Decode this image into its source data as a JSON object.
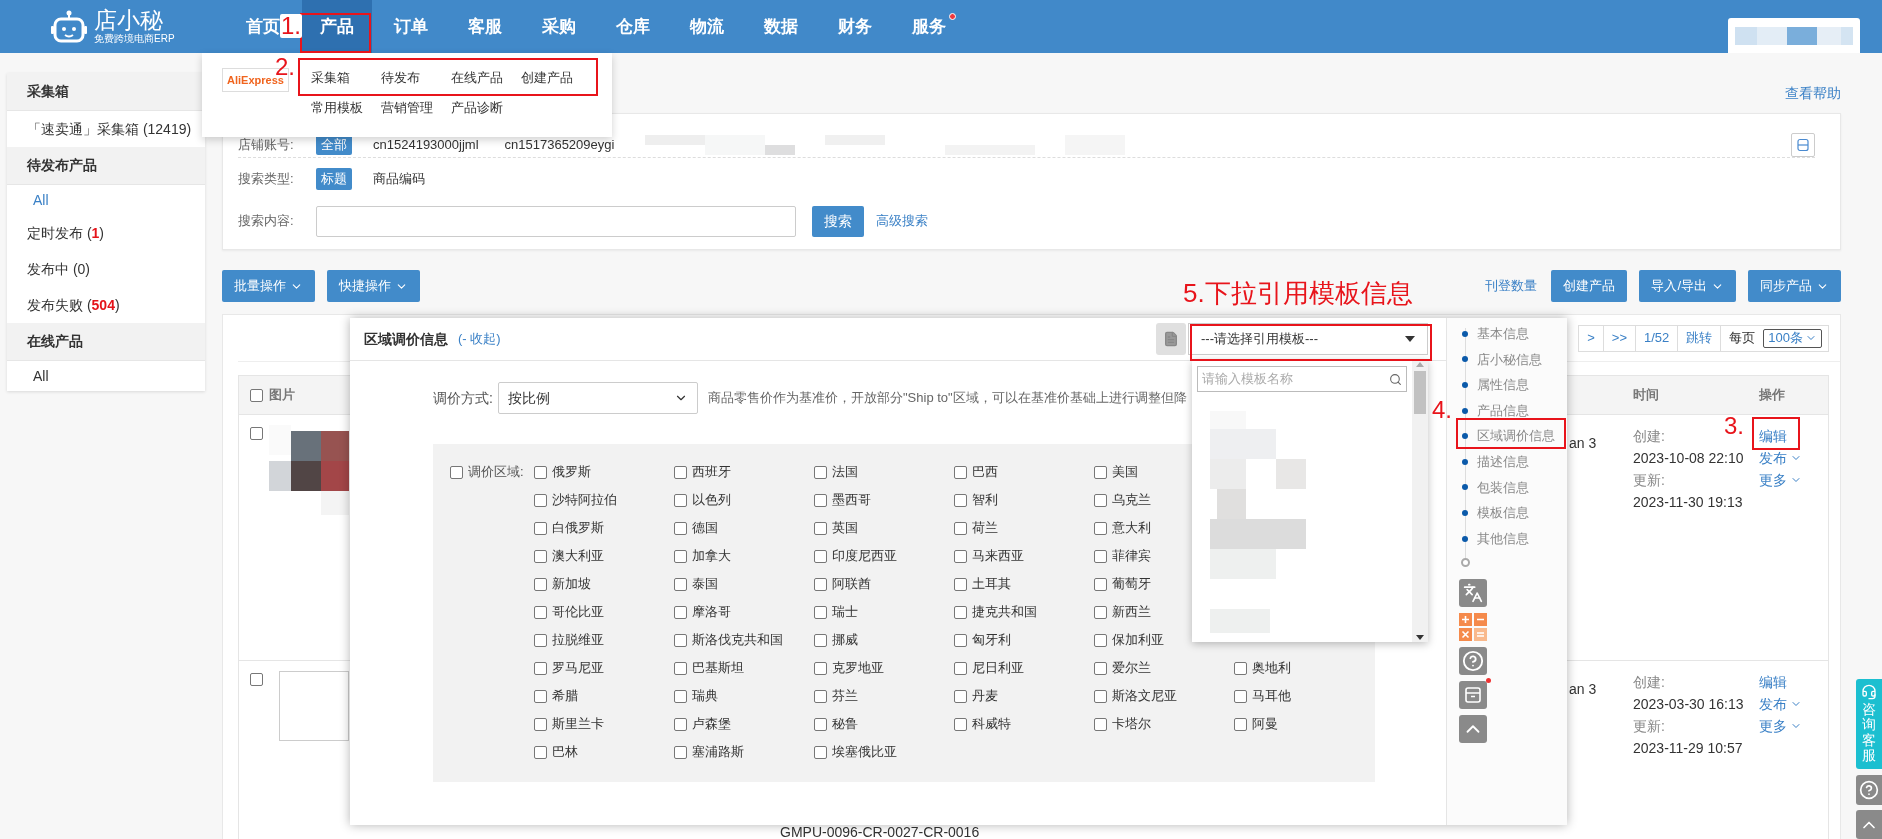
{
  "topbar": {
    "logo_name": "店小秘",
    "logo_tagline": "免费跨境电商ERP",
    "nav": [
      {
        "label": "首页",
        "selected": false,
        "badge": false
      },
      {
        "label": "产品",
        "selected": true,
        "badge": false
      },
      {
        "label": "订单",
        "selected": false,
        "badge": false
      },
      {
        "label": "客服",
        "selected": false,
        "badge": false
      },
      {
        "label": "采购",
        "selected": false,
        "badge": false
      },
      {
        "label": "仓库",
        "selected": false,
        "badge": false
      },
      {
        "label": "物流",
        "selected": false,
        "badge": false
      },
      {
        "label": "数据",
        "selected": false,
        "badge": false
      },
      {
        "label": "财务",
        "selected": false,
        "badge": false
      },
      {
        "label": "服务",
        "selected": false,
        "badge": true
      }
    ],
    "account": {
      "kind": "picture"
    }
  },
  "product_menu": {
    "platform": "AliExpress",
    "rows": [
      [
        "采集箱",
        "待发布",
        "在线产品",
        "创建产品"
      ],
      [
        "常用模板",
        "营销管理",
        "产品诊断"
      ]
    ]
  },
  "sidebar": {
    "sections": [
      {
        "title": "采集箱",
        "items": [
          {
            "label": "「速卖通」采集箱 (12419)",
            "selected": false
          }
        ]
      },
      {
        "title": "待发布产品",
        "items": [
          {
            "label": "All",
            "selected": true
          },
          {
            "label": "定时发布 (",
            "count": "1",
            "close": ")",
            "alert": true,
            "selected": false
          },
          {
            "label": "发布中 (",
            "count": "0",
            "close": ")",
            "alert": false,
            "selected": false
          },
          {
            "label": "发布失败 (",
            "count": "504",
            "close": ")",
            "alert": true,
            "selected": false
          }
        ]
      },
      {
        "title": "在线产品",
        "items": [
          {
            "label": "All",
            "selected": false
          }
        ]
      }
    ]
  },
  "help_link": "查看帮助",
  "filters": {
    "account": {
      "label": "店铺账号:",
      "options": [
        {
          "label": "全部",
          "selected": true
        },
        {
          "label": "cn1524193000jjml",
          "selected": false
        },
        {
          "label": "cn1517365209eygi",
          "selected": false
        }
      ]
    },
    "search_type": {
      "label": "搜索类型:",
      "options": [
        {
          "label": "标题",
          "selected": true
        },
        {
          "label": "商品编码",
          "selected": false
        }
      ]
    },
    "search_content": {
      "label": "搜索内容:",
      "button": "搜索",
      "advanced": "高级搜索"
    }
  },
  "toolbar": {
    "left": [
      {
        "label": "批量操作",
        "dropdown": true
      },
      {
        "label": "快捷操作",
        "dropdown": true
      }
    ],
    "link": "刊登数量",
    "right": [
      {
        "label": "创建产品",
        "dropdown": false
      },
      {
        "label": "导入/导出",
        "dropdown": true
      },
      {
        "label": "同步产品",
        "dropdown": true
      }
    ]
  },
  "pagination": {
    "buttons": [
      ">",
      ">>",
      "1/52",
      "跳转"
    ],
    "per_page_label": "每页",
    "per_page": "100条"
  },
  "table": {
    "columns": [
      "图片",
      "时间",
      "操作"
    ],
    "all_checked": false,
    "rows": [
      {
        "checked": false,
        "image": {
          "kind": "picture"
        },
        "column_3": "an 3",
        "created_label": "创建:",
        "created": "2023-10-08 22:10",
        "updated_label": "更新:",
        "updated": "2023-11-30 19:13",
        "actions": [
          {
            "label": "编辑",
            "dropdown": false
          },
          {
            "label": "发布",
            "dropdown": true
          },
          {
            "label": "更多",
            "dropdown": true
          }
        ]
      },
      {
        "checked": false,
        "image": {
          "kind": "empty"
        },
        "column_3": "an 3",
        "created_label": "创建:",
        "created": "2023-03-30 16:13",
        "updated_label": "更新:",
        "updated": "2023-11-29 10:57",
        "actions": [
          {
            "label": "编辑",
            "dropdown": false
          },
          {
            "label": "发布",
            "dropdown": true
          },
          {
            "label": "更多",
            "dropdown": true
          }
        ]
      }
    ],
    "footer_code": "GMPU-0096-CR-0027-CR-0016"
  },
  "panel": {
    "title": "区域调价信息",
    "collapse": "(- 收起)",
    "template_select": "---请选择引用模板---",
    "template_search_placeholder": "请输入模板名称",
    "price_mode_label": "调价方式:",
    "price_mode": "按比例",
    "description": "商品零售价作为基准价，开放部分\"Ship to\"区域，可以在基准价基础上进行调整但降",
    "region_label": "调价区域:",
    "region_all_checked": false,
    "regions": [
      [
        {
          "name": "俄罗斯",
          "checked": false
        },
        {
          "name": "西班牙",
          "checked": false
        },
        {
          "name": "法国",
          "checked": false
        },
        {
          "name": "巴西",
          "checked": false
        },
        {
          "name": "美国",
          "checked": false
        }
      ],
      [
        {
          "name": "沙特阿拉伯",
          "checked": false
        },
        {
          "name": "以色列",
          "checked": false
        },
        {
          "name": "墨西哥",
          "checked": false
        },
        {
          "name": "智利",
          "checked": false
        },
        {
          "name": "乌克兰",
          "checked": false
        }
      ],
      [
        {
          "name": "白俄罗斯",
          "checked": false
        },
        {
          "name": "德国",
          "checked": false
        },
        {
          "name": "英国",
          "checked": false
        },
        {
          "name": "荷兰",
          "checked": false
        },
        {
          "name": "意大利",
          "checked": false
        }
      ],
      [
        {
          "name": "澳大利亚",
          "checked": false
        },
        {
          "name": "加拿大",
          "checked": false
        },
        {
          "name": "印度尼西亚",
          "checked": false
        },
        {
          "name": "马来西亚",
          "checked": false
        },
        {
          "name": "菲律宾",
          "checked": false
        }
      ],
      [
        {
          "name": "新加坡",
          "checked": false
        },
        {
          "name": "泰国",
          "checked": false
        },
        {
          "name": "阿联酋",
          "checked": false
        },
        {
          "name": "土耳其",
          "checked": false
        },
        {
          "name": "葡萄牙",
          "checked": false
        }
      ],
      [
        {
          "name": "哥伦比亚",
          "checked": false
        },
        {
          "name": "摩洛哥",
          "checked": false
        },
        {
          "name": "瑞士",
          "checked": false
        },
        {
          "name": "捷克共和国",
          "checked": false
        },
        {
          "name": "新西兰",
          "checked": false
        }
      ],
      [
        {
          "name": "拉脱维亚",
          "checked": false
        },
        {
          "name": "斯洛伐克共和国",
          "checked": false
        },
        {
          "name": "挪威",
          "checked": false
        },
        {
          "name": "匈牙利",
          "checked": false
        },
        {
          "name": "保加利亚",
          "checked": false
        }
      ],
      [
        {
          "name": "罗马尼亚",
          "checked": false
        },
        {
          "name": "巴基斯坦",
          "checked": false
        },
        {
          "name": "克罗地亚",
          "checked": false
        },
        {
          "name": "尼日利亚",
          "checked": false
        },
        {
          "name": "爱尔兰",
          "checked": false
        },
        {
          "name": "奥地利",
          "checked": false
        }
      ],
      [
        {
          "name": "希腊",
          "checked": false
        },
        {
          "name": "瑞典",
          "checked": false
        },
        {
          "name": "芬兰",
          "checked": false
        },
        {
          "name": "丹麦",
          "checked": false
        },
        {
          "name": "斯洛文尼亚",
          "checked": false
        },
        {
          "name": "马耳他",
          "checked": false
        }
      ],
      [
        {
          "name": "斯里兰卡",
          "checked": false
        },
        {
          "name": "卢森堡",
          "checked": false
        },
        {
          "name": "秘鲁",
          "checked": false
        },
        {
          "name": "科威特",
          "checked": false
        },
        {
          "name": "卡塔尔",
          "checked": false
        },
        {
          "name": "阿曼",
          "checked": false
        }
      ],
      [
        {
          "name": "巴林",
          "checked": false
        },
        {
          "name": "塞浦路斯",
          "checked": false
        },
        {
          "name": "埃塞俄比亚",
          "checked": false
        }
      ]
    ],
    "side_nav": [
      "基本信息",
      "店小秘信息",
      "属性信息",
      "产品信息",
      "区域调价信息",
      "描述信息",
      "包装信息",
      "模板信息",
      "其他信息"
    ],
    "tools": [
      {
        "kind": "translate",
        "badge": false
      },
      {
        "kind": "calculator",
        "badge": false
      },
      {
        "kind": "help",
        "badge": false
      },
      {
        "kind": "archive",
        "badge": true
      },
      {
        "kind": "top",
        "badge": false
      }
    ]
  },
  "float": {
    "service": "咨询客服"
  },
  "annotations": [
    {
      "text": "1.",
      "kind": "step"
    },
    {
      "text": "2.",
      "kind": "step"
    },
    {
      "text": "3.",
      "kind": "step"
    },
    {
      "text": "4.",
      "kind": "step"
    },
    {
      "text": "5.下拉引用模板信息",
      "kind": "title"
    }
  ]
}
